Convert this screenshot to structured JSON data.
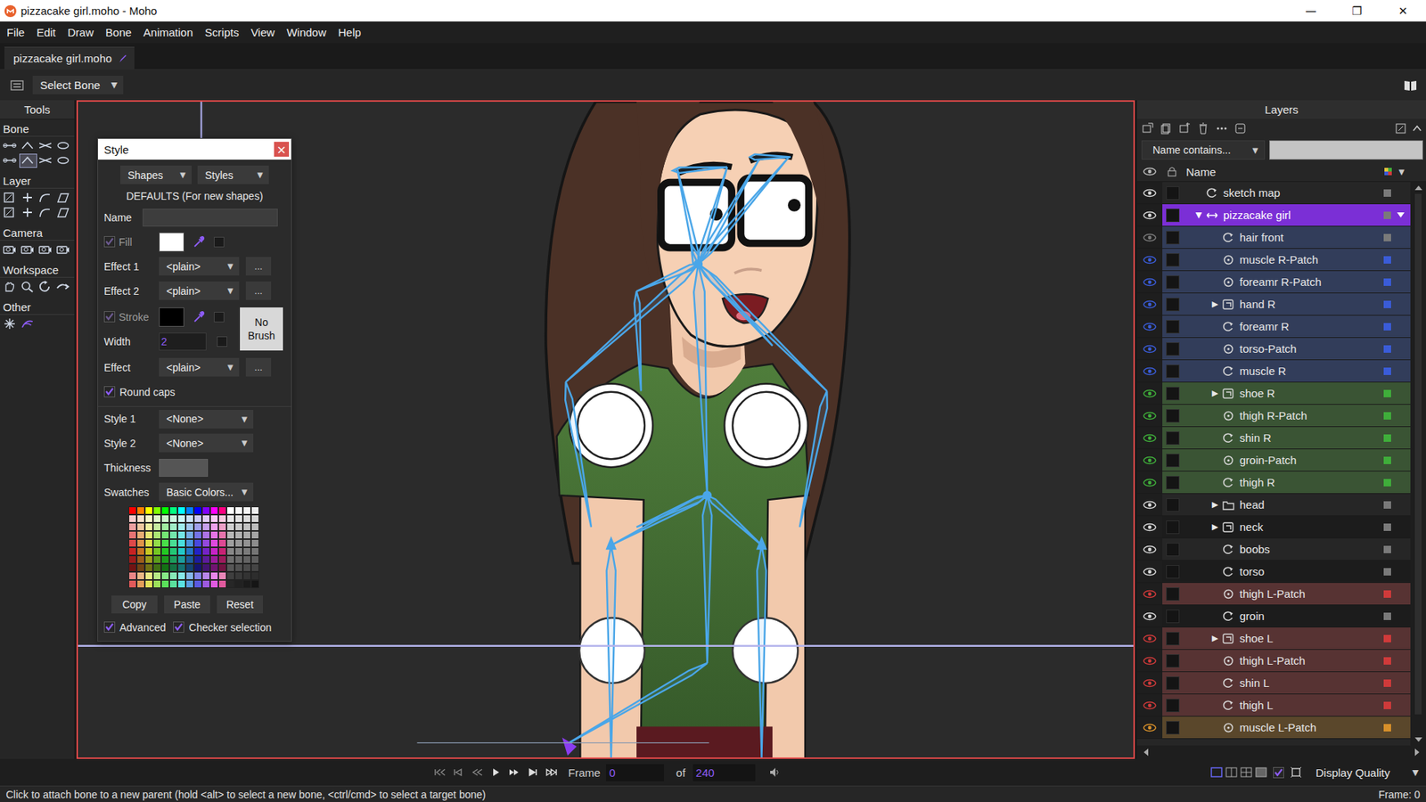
{
  "window": {
    "title": "pizzacake girl.moho - Moho",
    "controls": [
      "—",
      "❐",
      "✕"
    ]
  },
  "menu": [
    "File",
    "Edit",
    "Draw",
    "Bone",
    "Animation",
    "Scripts",
    "View",
    "Window",
    "Help"
  ],
  "doc_tabs": [
    {
      "label": "pizzacake girl.moho",
      "selected": true
    }
  ],
  "toolbar": {
    "tool": "Select Bone",
    "arrow": "▼"
  },
  "tools": {
    "title": "Tools",
    "sections": [
      {
        "label": "Bone",
        "items": [
          {
            "selected": false
          },
          {
            "selected": false
          },
          {
            "selected": false
          },
          {
            "selected": false
          },
          {
            "selected": false
          },
          {
            "selected": true
          },
          {
            "selected": false
          },
          {
            "selected": false
          }
        ]
      },
      {
        "label": "Layer",
        "items": [
          {
            "selected": false
          },
          {
            "selected": false
          },
          {
            "selected": false
          },
          {
            "selected": false
          },
          {
            "selected": false
          },
          {
            "selected": false
          },
          {
            "selected": false
          },
          {
            "selected": false
          }
        ]
      },
      {
        "label": "Camera",
        "items": [
          {
            "selected": false
          },
          {
            "selected": false
          },
          {
            "selected": false
          },
          {
            "selected": false
          }
        ]
      },
      {
        "label": "Workspace",
        "items": [
          {
            "selected": false
          },
          {
            "selected": false
          },
          {
            "selected": false
          },
          {
            "selected": false
          }
        ]
      },
      {
        "label": "Other",
        "items": [
          {
            "selected": false
          },
          {
            "selected": false
          }
        ]
      }
    ]
  },
  "style": {
    "title": "Style",
    "close": "×",
    "menus": [
      {
        "label": "Shapes",
        "arrow": "▼"
      },
      {
        "label": "Styles",
        "arrow": "▼"
      }
    ],
    "heading": "DEFAULTS (For new shapes)",
    "name": {
      "label": "Name",
      "value": ""
    },
    "fill": {
      "label": "Fill",
      "checked": true,
      "disabled": true,
      "color": "#ffffff"
    },
    "effect1": {
      "label": "Effect 1",
      "value": "<plain>",
      "arrow": "▼",
      "more": "..."
    },
    "effect2": {
      "label": "Effect 2",
      "value": "<plain>",
      "arrow": "▼",
      "more": "..."
    },
    "stroke": {
      "label": "Stroke",
      "checked": true,
      "disabled": true,
      "color": "#000000"
    },
    "brush": "No Brush",
    "width": {
      "label": "Width",
      "value": "2"
    },
    "effect": {
      "label": "Effect",
      "value": "<plain>",
      "arrow": "▼",
      "more": "..."
    },
    "round_caps": {
      "label": "Round caps",
      "checked": true
    },
    "style1": {
      "label": "Style 1",
      "value": "<None>",
      "arrow": "▼"
    },
    "style2": {
      "label": "Style 2",
      "value": "<None>",
      "arrow": "▼"
    },
    "thickness": {
      "label": "Thickness",
      "value": ""
    },
    "swatches": {
      "label": "Swatches",
      "value": "Basic Colors...",
      "arrow": "▼"
    },
    "buttons": [
      "Copy",
      "Paste",
      "Reset"
    ],
    "options": [
      {
        "label": "Advanced",
        "checked": true
      },
      {
        "label": "Checker selection",
        "checked": true
      }
    ]
  },
  "layers": {
    "title": "Layers",
    "filter": {
      "label": "Name contains...",
      "arrow": "▼",
      "value": ""
    },
    "column": "Name",
    "column_arrow": "▼",
    "rows": [
      {
        "name": "sketch map",
        "kind": "vector",
        "depth": 0,
        "expander": "",
        "color": "#7a7a7a",
        "tint": "#262626",
        "selected": false,
        "visible": true
      },
      {
        "name": "pizzacake girl",
        "kind": "bone",
        "depth": 0,
        "expander": "▼",
        "color": "#7a7a7a",
        "tint": "#262626",
        "selected": true,
        "visible": true
      },
      {
        "name": "hair front",
        "kind": "vector",
        "depth": 1,
        "expander": "",
        "color": "#7a7a7a",
        "tint": "#323d5a",
        "selected": false,
        "visible": true
      },
      {
        "name": "muscle R-Patch",
        "kind": "patch",
        "depth": 1,
        "expander": "",
        "color": "#3a5cd8",
        "tint": "#323d5a",
        "selected": false,
        "visible": true
      },
      {
        "name": "foreamr R-Patch",
        "kind": "patch",
        "depth": 1,
        "expander": "",
        "color": "#3a5cd8",
        "tint": "#323d5a",
        "selected": false,
        "visible": true
      },
      {
        "name": "hand R",
        "kind": "switch",
        "depth": 1,
        "expander": "▶",
        "color": "#3a5cd8",
        "tint": "#323d5a",
        "selected": false,
        "visible": true
      },
      {
        "name": "foreamr R",
        "kind": "vector",
        "depth": 1,
        "expander": "",
        "color": "#3a5cd8",
        "tint": "#323d5a",
        "selected": false,
        "visible": true
      },
      {
        "name": "torso-Patch",
        "kind": "patch",
        "depth": 1,
        "expander": "",
        "color": "#3a5cd8",
        "tint": "#323d5a",
        "selected": false,
        "visible": true
      },
      {
        "name": "muscle R",
        "kind": "vector",
        "depth": 1,
        "expander": "",
        "color": "#3a5cd8",
        "tint": "#323d5a",
        "selected": false,
        "visible": true
      },
      {
        "name": "shoe R",
        "kind": "switch",
        "depth": 1,
        "expander": "▶",
        "color": "#3fae3a",
        "tint": "#3a5434",
        "selected": false,
        "visible": true
      },
      {
        "name": "thigh R-Patch",
        "kind": "patch",
        "depth": 1,
        "expander": "",
        "color": "#3fae3a",
        "tint": "#3a5434",
        "selected": false,
        "visible": true
      },
      {
        "name": "shin R",
        "kind": "vector",
        "depth": 1,
        "expander": "",
        "color": "#3fae3a",
        "tint": "#3a5434",
        "selected": false,
        "visible": true
      },
      {
        "name": "groin-Patch",
        "kind": "patch",
        "depth": 1,
        "expander": "",
        "color": "#3fae3a",
        "tint": "#3a5434",
        "selected": false,
        "visible": true
      },
      {
        "name": "thigh R",
        "kind": "vector",
        "depth": 1,
        "expander": "",
        "color": "#3fae3a",
        "tint": "#3a5434",
        "selected": false,
        "visible": true
      },
      {
        "name": "head",
        "kind": "group",
        "depth": 1,
        "expander": "▶",
        "color": "#7a7a7a",
        "tint": "#262626",
        "selected": false,
        "visible": true
      },
      {
        "name": "neck",
        "kind": "switch",
        "depth": 1,
        "expander": "▶",
        "color": "#7a7a7a",
        "tint": "#1c1c1c",
        "selected": false,
        "visible": true
      },
      {
        "name": "boobs",
        "kind": "vector",
        "depth": 1,
        "expander": "",
        "color": "#7a7a7a",
        "tint": "#262626",
        "selected": false,
        "visible": true
      },
      {
        "name": "torso",
        "kind": "vector",
        "depth": 1,
        "expander": "",
        "color": "#7a7a7a",
        "tint": "#1c1c1c",
        "selected": false,
        "visible": true
      },
      {
        "name": "thigh L-Patch",
        "kind": "patch",
        "depth": 1,
        "expander": "",
        "color": "#d03a3a",
        "tint": "#573333",
        "selected": false,
        "visible": true
      },
      {
        "name": "groin",
        "kind": "vector",
        "depth": 1,
        "expander": "",
        "color": "#7a7a7a",
        "tint": "#1c1c1c",
        "selected": false,
        "visible": true
      },
      {
        "name": "shoe L",
        "kind": "switch",
        "depth": 1,
        "expander": "▶",
        "color": "#d03a3a",
        "tint": "#573333",
        "selected": false,
        "visible": true
      },
      {
        "name": "thigh L-Patch",
        "kind": "patch",
        "depth": 1,
        "expander": "",
        "color": "#d03a3a",
        "tint": "#573333",
        "selected": false,
        "visible": true
      },
      {
        "name": "shin L",
        "kind": "vector",
        "depth": 1,
        "expander": "",
        "color": "#d03a3a",
        "tint": "#573333",
        "selected": false,
        "visible": true
      },
      {
        "name": "thigh L",
        "kind": "vector",
        "depth": 1,
        "expander": "",
        "color": "#d03a3a",
        "tint": "#573333",
        "selected": false,
        "visible": true
      },
      {
        "name": "muscle L-Patch",
        "kind": "patch",
        "depth": 1,
        "expander": "",
        "color": "#d8902a",
        "tint": "#5a472b",
        "selected": false,
        "visible": true
      }
    ]
  },
  "timeline": {
    "frame_label": "Frame",
    "frame": "0",
    "of": "of",
    "total": "240"
  },
  "view": {
    "checked": true,
    "quality": "Display Quality",
    "arrow": "▼"
  },
  "status_bar": {
    "hint": "Click to attach bone to a new parent (hold <alt> to select a new bone, <ctrl/cmd> to select a target bone)",
    "frame": "Frame: 0"
  }
}
